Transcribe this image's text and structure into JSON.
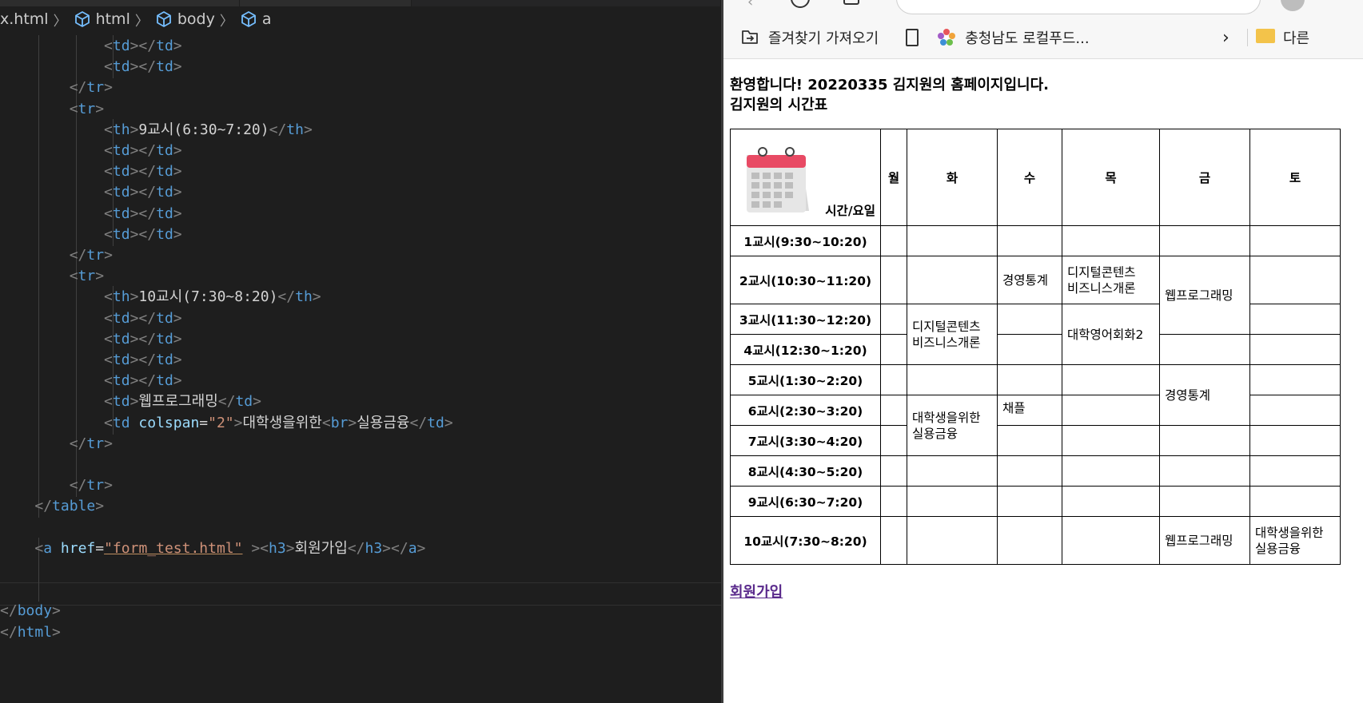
{
  "editor": {
    "breadcrumb": [
      "x.html",
      "html",
      "body",
      "a"
    ],
    "lines": [
      [
        "<td></td>"
      ],
      [
        "<td></td>"
      ],
      [
        "</tr>"
      ],
      [
        "<tr>"
      ],
      [
        "<th>9교시(6:30~7:20)</th>"
      ],
      [
        "<td></td>"
      ],
      [
        "<td></td>"
      ],
      [
        "<td></td>"
      ],
      [
        "<td></td>"
      ],
      [
        "<td></td>"
      ],
      [
        "</tr>"
      ],
      [
        "<tr>"
      ],
      [
        "<th>10교시(7:30~8:20)</th>"
      ],
      [
        "<td></td>"
      ],
      [
        "<td></td>"
      ],
      [
        "<td></td>"
      ],
      [
        "<td></td>"
      ],
      [
        "<td>웹프로그래밍</td>"
      ],
      [
        "<td colspan=\"2\">대학생을위한<br>실용금융</td>"
      ],
      [
        "</tr>"
      ],
      [
        ""
      ],
      [
        "</tr>"
      ],
      [
        "</table>"
      ],
      [
        ""
      ],
      [
        "<a href=\"form_test.html\" ><h3>회원가입</h3></a>"
      ],
      [
        ""
      ],
      [
        ""
      ],
      [
        "</body>"
      ],
      [
        "</html>"
      ]
    ]
  },
  "browser": {
    "favorites": [
      "즐겨찾기 가져오기",
      "충청남도 로컬푸드...",
      "다른"
    ],
    "welcome": "환영합니다! 20220335 김지원의 홈페이지입니다.",
    "table_title": "김지원의 시간표",
    "corner_label": "시간/요일",
    "days": [
      "월",
      "화",
      "수",
      "목",
      "금",
      "토"
    ],
    "periods": [
      "1교시(9:30~10:20)",
      "2교시(10:30~11:20)",
      "3교시(11:30~12:20)",
      "4교시(12:30~1:20)",
      "5교시(1:30~2:20)",
      "6교시(2:30~3:20)",
      "7교시(3:30~4:20)",
      "8교시(4:30~5:20)",
      "9교시(6:30~7:20)",
      "10교시(7:30~8:20)"
    ],
    "courses": {
      "tue_34": [
        "디지털콘텐츠",
        "비즈니스개론"
      ],
      "tue_67": [
        "대학생을위한",
        "실용금융"
      ],
      "wed_2": "경영통계",
      "wed_6": "채플",
      "thu_2": [
        "디지털콘텐츠",
        "비즈니스개론"
      ],
      "thu_34": "대학영어회화2",
      "fri_23": "웹프로그래밍",
      "fri_56": "경영통계",
      "fri_10": "웹프로그래밍",
      "sat_10": [
        "대학생을위한",
        "실용금융"
      ]
    },
    "signup_link": "회원가입"
  }
}
